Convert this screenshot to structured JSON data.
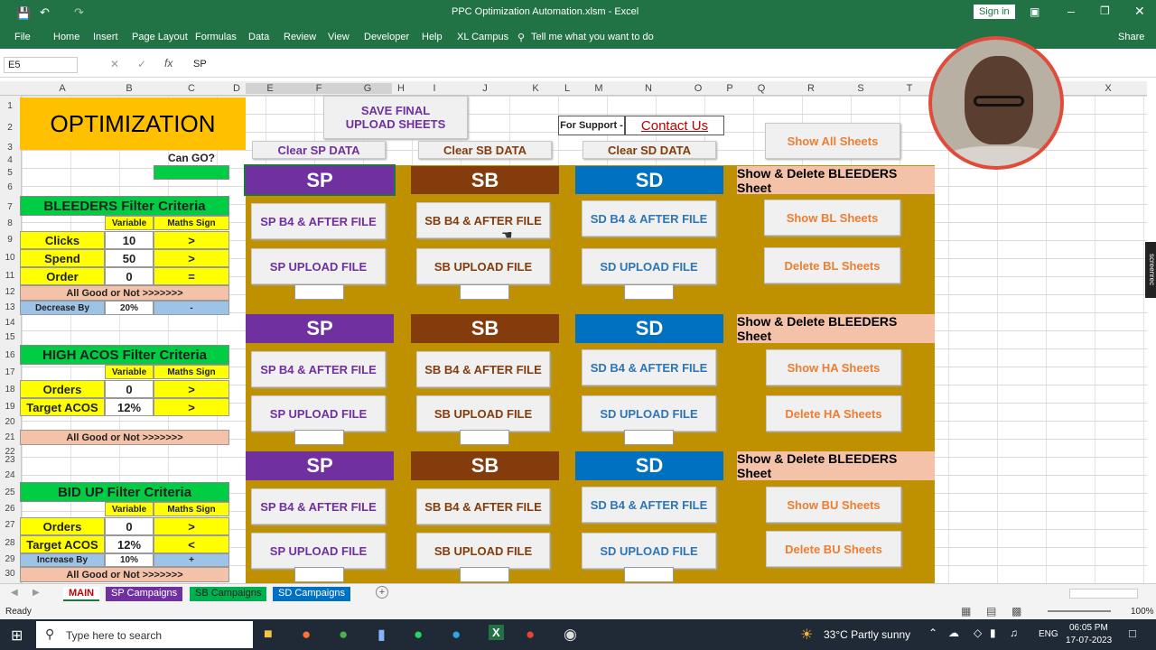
{
  "window": {
    "title": "PPC Optimization Automation.xlsm  -  Excel",
    "sign_in": "Sign in"
  },
  "ribbon": {
    "tabs": [
      "File",
      "Home",
      "Insert",
      "Page Layout",
      "Formulas",
      "Data",
      "Review",
      "View",
      "Developer",
      "Help",
      "XL Campus"
    ],
    "tell_me": "Tell me what you want to do",
    "share": "Share"
  },
  "formula_bar": {
    "name_box": "E5",
    "formula": "SP"
  },
  "columns": [
    "A",
    "B",
    "C",
    "D",
    "E",
    "F",
    "G",
    "H",
    "I",
    "J",
    "K",
    "L",
    "M",
    "N",
    "O",
    "P",
    "Q",
    "R",
    "S",
    "T",
    "X"
  ],
  "rows": [
    "1",
    "2",
    "3",
    "4",
    "5",
    "6",
    "7",
    "8",
    "9",
    "10",
    "11",
    "12",
    "13",
    "14",
    "15",
    "16",
    "17",
    "18",
    "19",
    "20",
    "21",
    "22",
    "23",
    "24",
    "25",
    "26",
    "27",
    "28",
    "29",
    "30"
  ],
  "left": {
    "title": "OPTIMIZATION",
    "can_go": "Can GO?",
    "bleeders": {
      "heading": "BLEEDERS Filter Criteria",
      "variable": "Variable",
      "maths": "Maths Sign",
      "rows": [
        {
          "k": "Clicks",
          "v": "10",
          "s": ">"
        },
        {
          "k": "Spend",
          "v": "50",
          "s": ">"
        },
        {
          "k": "Order",
          "v": "0",
          "s": "="
        }
      ],
      "all_good": "All Good or Not >>>>>>>",
      "decrease_label": "Decrease By",
      "decrease_val": "20%",
      "decrease_sign": "-"
    },
    "high_acos": {
      "heading": "HIGH ACOS Filter Criteria",
      "variable": "Variable",
      "maths": "Maths Sign",
      "rows": [
        {
          "k": "Orders",
          "v": "0",
          "s": ">"
        },
        {
          "k": "Target ACOS",
          "v": "12%",
          "s": ">"
        }
      ],
      "all_good": "All Good or Not >>>>>>>"
    },
    "bid_up": {
      "heading": "BID UP Filter Criteria",
      "variable": "Variable",
      "maths": "Maths Sign",
      "rows": [
        {
          "k": "Orders",
          "v": "0",
          "s": ">"
        },
        {
          "k": "Target ACOS",
          "v": "12%",
          "s": "<"
        }
      ],
      "increase_label": "Increase By",
      "increase_val": "10%",
      "increase_sign": "+",
      "all_good": "All Good or Not >>>>>>>"
    }
  },
  "top": {
    "save": "SAVE FINAL UPLOAD SHEETS",
    "support": "For Support -",
    "contact": "Contact Us",
    "clear_sp": "Clear SP DATA",
    "clear_sb": "Clear SB DATA",
    "clear_sd": "Clear SD DATA",
    "show_all": "Show All Sheets"
  },
  "bands": {
    "sp": "SP",
    "sb": "SB",
    "sd": "SD",
    "show_delete": "Show & Delete BLEEDERS Sheet"
  },
  "buttons": {
    "sp_b4": "SP B4 & AFTER FILE",
    "sp_up": "SP UPLOAD FILE",
    "sb_b4": "SB B4 & AFTER FILE",
    "sb_up": "SB UPLOAD FILE",
    "sd_b4": "SD B4 & AFTER FILE",
    "sd_up": "SD UPLOAD FILE",
    "show_bl": "Show BL Sheets",
    "del_bl": "Delete BL Sheets",
    "show_ha": "Show HA Sheets",
    "del_ha": "Delete HA Sheets",
    "show_bu": "Show BU Sheets",
    "del_bu": "Delete BU Sheets"
  },
  "sheet_tabs": [
    "MAIN",
    "SP Campaigns",
    "SB Campaigns",
    "SD Campaigns"
  ],
  "status": {
    "ready": "Ready",
    "zoom": "100%"
  },
  "taskbar": {
    "search": "Type here to search",
    "weather": "33°C  Partly sunny",
    "lang": "ENG",
    "time": "06:05 PM",
    "date": "17-07-2023",
    "screenrec": "screenrec"
  },
  "colors": {
    "excel_green": "#217346",
    "sp_purple": "#7030a0",
    "sb_brown": "#843c0c",
    "sd_blue": "#0070c0",
    "olive": "#bf9000",
    "sp_text": "#7030a0",
    "sb_text": "#843c0c",
    "sd_text": "#2e75b6",
    "orange_text": "#ed7d31"
  }
}
